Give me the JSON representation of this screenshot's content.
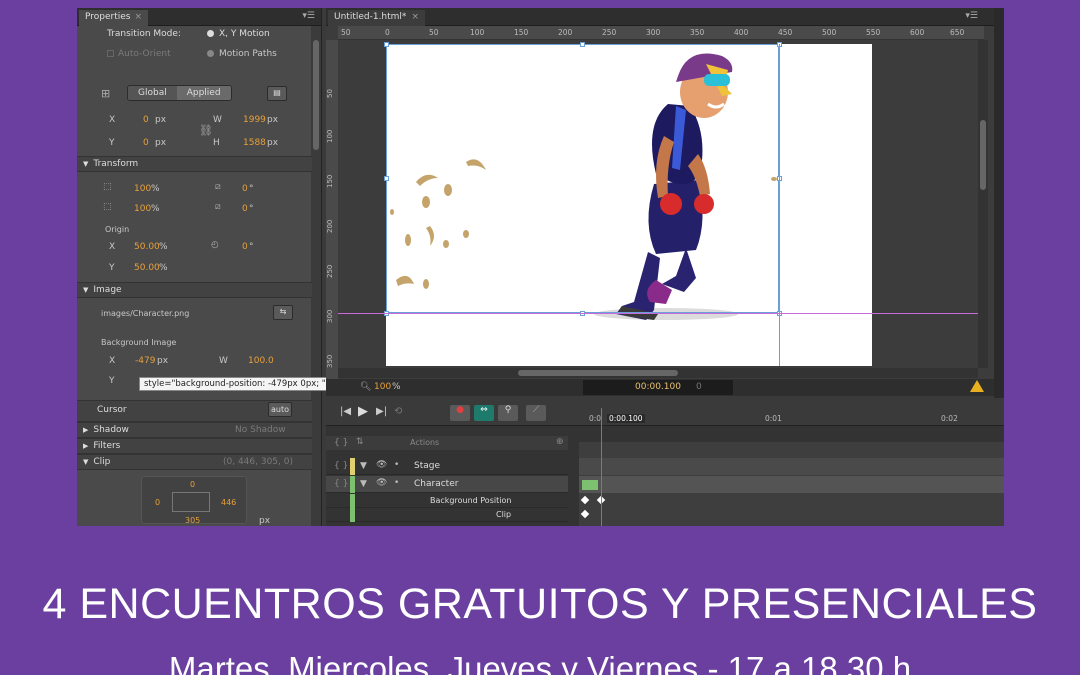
{
  "properties": {
    "tab_label": "Properties",
    "transition_mode_label": "Transition Mode:",
    "transition_xy": "X, Y Motion",
    "auto_orient": "Auto-Orient",
    "motion_paths": "Motion Paths",
    "global_label": "Global",
    "applied_label": "Applied",
    "x_label": "X",
    "y_label": "Y",
    "x_value": "0",
    "y_value": "0",
    "px": "px",
    "w_label": "W",
    "h_label": "H",
    "w_value": "1999",
    "h_value": "1588",
    "transform_section": "Transform",
    "scale_x": "100",
    "scale_y": "100",
    "pct": "%",
    "skew_x": "0",
    "skew_y": "0",
    "deg": "°",
    "origin_label": "Origin",
    "origin_x": "50.00",
    "origin_y": "50.00",
    "rotate": "0",
    "image_section": "Image",
    "image_path": "images/Character.png",
    "bg_image_label": "Background Image",
    "bg_x": "-479",
    "bg_w_label": "W",
    "bg_w": "100.0",
    "tooltip": "style=\"background-position: -479px 0px; \"",
    "cursor_label": "Cursor",
    "cursor_value": "auto",
    "shadow_label": "Shadow",
    "shadow_value": "No Shadow",
    "filters_label": "Filters",
    "clip_label": "Clip",
    "clip_value": "(0, 446, 305, 0)",
    "clip_top": "0",
    "clip_left": "0",
    "clip_right": "446",
    "clip_bottom": "305",
    "clip_unit": "px"
  },
  "stage": {
    "tab_label": "Untitled-1.html*",
    "ruler_ticks": [
      "50",
      "0",
      "50",
      "100",
      "150",
      "200",
      "250",
      "300",
      "350",
      "400",
      "450",
      "500",
      "550",
      "600",
      "650"
    ],
    "vruler_ticks": [
      "50",
      "100",
      "150",
      "200",
      "250",
      "300",
      "350"
    ],
    "zoom": "100",
    "time": "00:00.100",
    "time_end": "0"
  },
  "timeline": {
    "actions_label": "Actions",
    "stage_label": "Stage",
    "character_label": "Character",
    "bg_position_label": "Background Position",
    "clip_label": "Clip",
    "playhead_label": "0:00.100",
    "ruler_ticks": [
      "0:0",
      "0:01",
      "0:02"
    ]
  },
  "footer": {
    "headline": "4 ENCUENTROS GRATUITOS Y PRESENCIALES",
    "subline": "Martes, Miercoles, Jueves y Viernes - 17 a 18.30 h"
  },
  "colors": {
    "background": "#6a3fa0",
    "accent_orange": "#e8a03a",
    "stage_strip": "#e0d070",
    "character_strip": "#7cc070"
  }
}
